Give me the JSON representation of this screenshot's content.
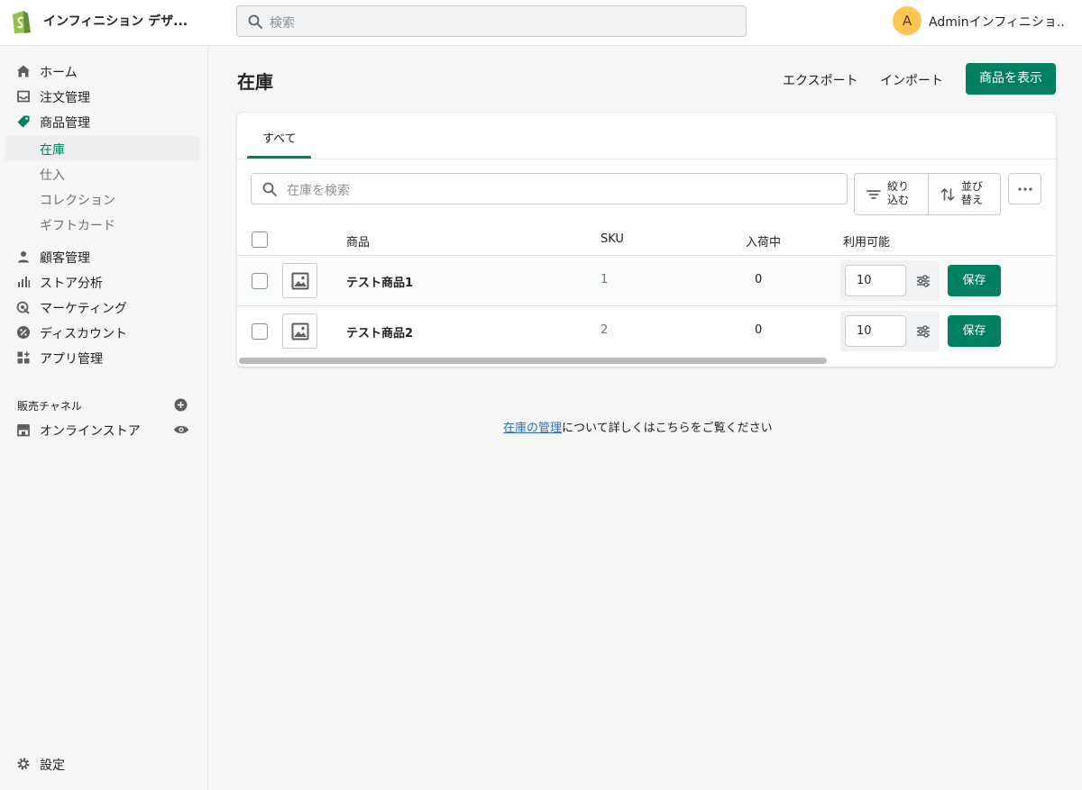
{
  "topbar": {
    "store_name": "インフィニション デザ...",
    "search_placeholder": "検索",
    "avatar_initial": "A",
    "user_name": "Adminインフィニショ..."
  },
  "sidebar": {
    "items": [
      {
        "label": "ホーム",
        "icon": "home-icon"
      },
      {
        "label": "注文管理",
        "icon": "inbox-icon"
      },
      {
        "label": "商品管理",
        "icon": "tag-icon"
      }
    ],
    "sub_items": [
      {
        "label": "在庫",
        "active": true
      },
      {
        "label": "仕入",
        "active": false
      },
      {
        "label": "コレクション",
        "active": false
      },
      {
        "label": "ギフトカード",
        "active": false
      }
    ],
    "items2": [
      {
        "label": "顧客管理",
        "icon": "person-icon"
      },
      {
        "label": "ストア分析",
        "icon": "bar-chart-icon"
      },
      {
        "label": "マーケティング",
        "icon": "target-icon"
      },
      {
        "label": "ディスカウント",
        "icon": "discount-icon"
      },
      {
        "label": "アプリ管理",
        "icon": "apps-icon"
      }
    ],
    "sales_channels_label": "販売チャネル",
    "online_store_label": "オンラインストア",
    "settings_label": "設定"
  },
  "main": {
    "title": "在庫",
    "export_label": "エクスポート",
    "import_label": "インポート",
    "view_products_label": "商品を表示",
    "tab_all": "すべて",
    "search_placeholder": "在庫を検索",
    "filter_label_1": "絞り",
    "filter_label_2": "込む",
    "sort_label_1": "並び",
    "sort_label_2": "替え",
    "table": {
      "headers": {
        "product": "商品",
        "sku": "SKU",
        "incoming": "入荷中",
        "available": "利用可能"
      },
      "rows": [
        {
          "name": "テスト商品1",
          "sku": "1",
          "incoming": "0",
          "available": "10",
          "save": "保存"
        },
        {
          "name": "テスト商品2",
          "sku": "2",
          "incoming": "0",
          "available": "10",
          "save": "保存"
        }
      ]
    },
    "help_link": "在庫の管理",
    "help_text": "について詳しくはこちらをご覧ください"
  },
  "colors": {
    "accent": "#008060",
    "link": "#2c6ecb"
  }
}
